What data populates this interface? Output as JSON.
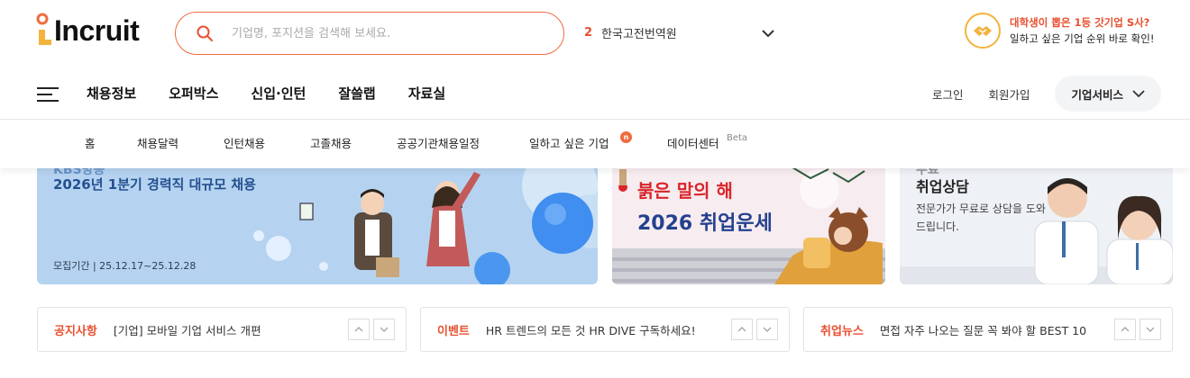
{
  "header": {
    "logo_text": "Incruit",
    "search": {
      "placeholder": "기업명, 포지션을 검색해 보세요."
    },
    "rank": {
      "number": "2",
      "keyword": "한국고전번역원"
    },
    "promo": {
      "line1": "대학생이 뽑은 1등 갓기업 S사?",
      "line2": "일하고 싶은 기업 순위 바로 확인!"
    }
  },
  "gnb": {
    "items": [
      "채용정보",
      "오퍼박스",
      "신입·인턴",
      "잘쓸랩",
      "자료실"
    ],
    "login": "로그인",
    "signup": "회원가입",
    "corp_service": "기업서비스"
  },
  "subnav": {
    "items": [
      "홈",
      "채용달력",
      "인턴채용",
      "고졸채용",
      "공공기관채용일정",
      "일하고 싶은 기업",
      "데이터센터"
    ],
    "new_badge": "n",
    "beta": "Beta"
  },
  "banners": {
    "b1": {
      "title": "2026년 1분기 경력직 대규모 채용",
      "period": "모집기간 | 25.12.17~25.12.28"
    },
    "b2": {
      "line1": "붉은 말의 해",
      "line2": "2026 취업운세"
    },
    "b3": {
      "title": "취업상담",
      "desc": "전문가가 무료로 상담을 도와 드립니다."
    }
  },
  "notices": [
    {
      "category": "공지사항",
      "message": "[기업] 모바일 기업 서비스 개편"
    },
    {
      "category": "이벤트",
      "message": "HR 트렌드의 모든 것 HR DIVE 구독하세요!"
    },
    {
      "category": "취업뉴스",
      "message": "면접 자주 나오는 질문 꼭 봐야 할 BEST 10"
    }
  ],
  "colors": {
    "accent": "#e8502f",
    "logo_yellow": "#f3b33d",
    "banner1_bg": "#b5d3f0"
  },
  "icons": [
    "search-icon",
    "chevron-down-icon",
    "handshake-icon",
    "hamburger-icon",
    "arrow-up-icon",
    "arrow-down-icon"
  ]
}
